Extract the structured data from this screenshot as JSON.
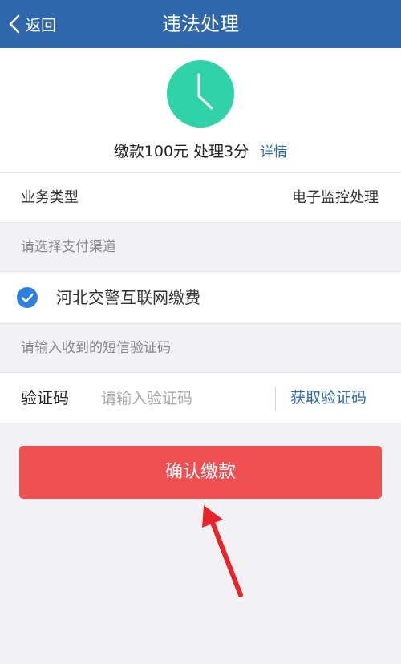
{
  "header": {
    "back_label": "返回",
    "title": "违法处理",
    "background_color": "#2f67ad"
  },
  "summary": {
    "icon": "clock-icon",
    "icon_color": "#2fd3a7",
    "text": "缴款100元 处理3分",
    "detail_link": "详情"
  },
  "business_type": {
    "label": "业务类型",
    "value": "电子监控处理"
  },
  "payment": {
    "section_title": "请选择支付渠道",
    "channels": [
      {
        "label": "河北交警互联网缴费",
        "selected": true,
        "icon": "check-circle-icon"
      }
    ]
  },
  "sms": {
    "section_title": "请输入收到的短信验证码",
    "code_label": "验证码",
    "code_value": "",
    "code_placeholder": "请输入验证码",
    "get_code_label": "获取验证码"
  },
  "confirm_button": {
    "label": "确认缴款",
    "color": "#ef5152"
  },
  "annotation": {
    "icon": "red-arrow-icon",
    "color": "#e8232a"
  }
}
